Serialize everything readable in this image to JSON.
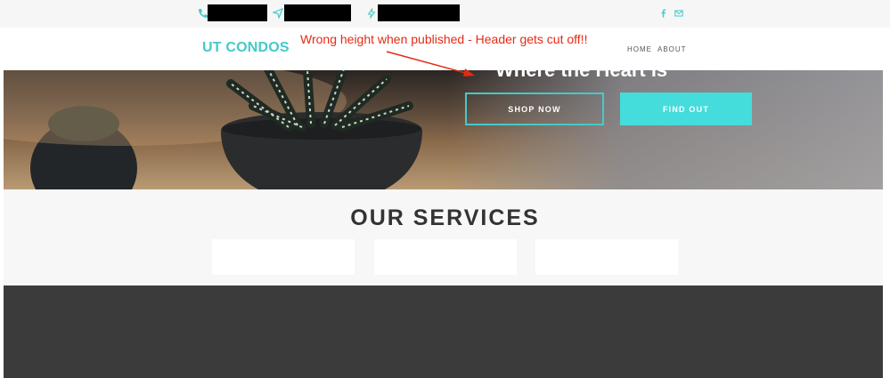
{
  "topbar": {
    "phone_icon": "phone-icon",
    "send_icon": "paper-plane-icon",
    "bolt_icon": "bolt-icon",
    "social": [
      "facebook-icon",
      "mail-icon"
    ]
  },
  "nav": {
    "logo": "UT CONDOS",
    "menu": [
      "HOME",
      "ABOUT"
    ]
  },
  "annotation": {
    "text": "Wrong height when published - Header gets cut off!!"
  },
  "hero": {
    "heading": "Where the Heart is",
    "buttons": {
      "shop": "SHOP NOW",
      "find": "FIND OUT"
    }
  },
  "services": {
    "title": "OUR SERVICES"
  },
  "colors": {
    "accent": "#45c9c9",
    "annotation": "#e52a14",
    "dark_section": "#3b3b3b"
  }
}
